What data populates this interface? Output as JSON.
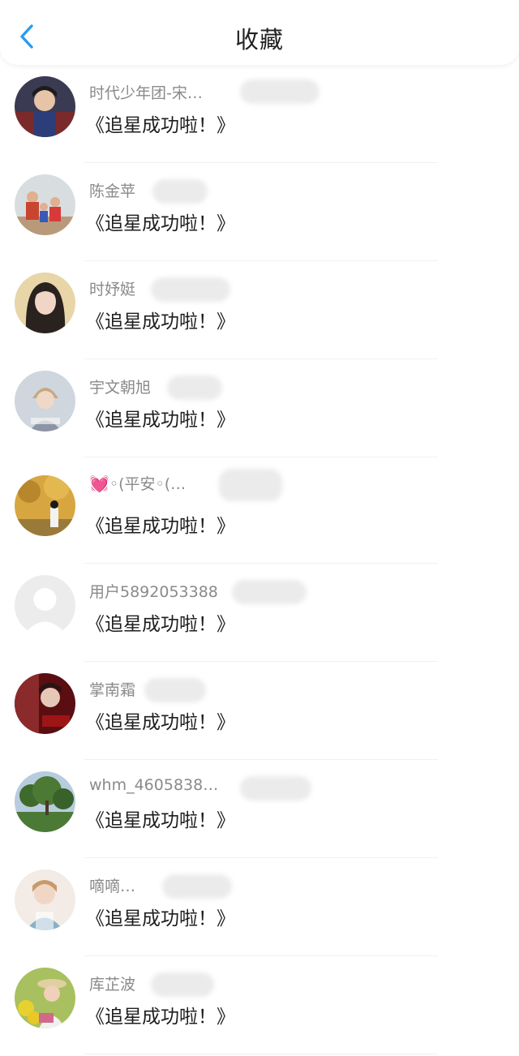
{
  "header": {
    "title": "收藏",
    "back_icon": "chevron-left-icon",
    "accent_color": "#2b9bf0"
  },
  "favorites": [
    {
      "name": "时代少年团-宋…",
      "message": "《追星成功啦！》"
    },
    {
      "name": "陈金苹",
      "message": "《追星成功啦！》"
    },
    {
      "name": "时妤娗",
      "message": "《追星成功啦！》"
    },
    {
      "name": "宇文朝旭",
      "message": "《追星成功啦！》"
    },
    {
      "name": "◦(平安◦(…",
      "heart": "💓",
      "message": "《追星成功啦！》"
    },
    {
      "name": "用户5892053388",
      "message": "《追星成功啦！》"
    },
    {
      "name": "掌南霜",
      "message": "《追星成功啦！》"
    },
    {
      "name": "whm_4605838…",
      "message": "《追星成功啦！》"
    },
    {
      "name": "嘀嘀…",
      "message": "《追星成功啦！》"
    },
    {
      "name": "库芷波",
      "message": "《追星成功啦！》"
    }
  ]
}
